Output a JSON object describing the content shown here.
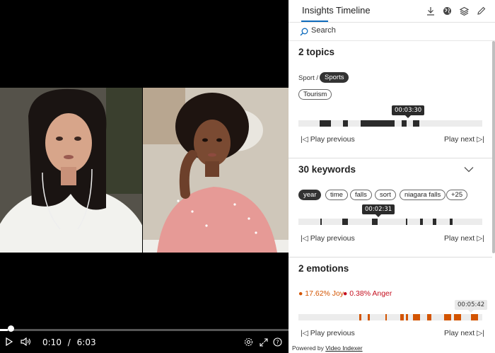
{
  "player": {
    "time_current": "0:10",
    "time_separator": "/",
    "time_total": "6:03",
    "progress": 0.028,
    "icons": {
      "play": "play-icon",
      "volume": "volume-icon",
      "settings": "settings-icon",
      "fullscreen": "fullscreen-icon",
      "help": "help-icon"
    }
  },
  "pane": {
    "tabs": [
      {
        "label": "Insights",
        "active": true
      },
      {
        "label": "Timeline",
        "active": false
      }
    ],
    "toolbar_icons": [
      "download-icon",
      "globe-icon",
      "layers-icon",
      "edit-icon"
    ],
    "search": {
      "placeholder": "Search"
    },
    "topics": {
      "title": "2 topics",
      "path_prefix": "Sport /",
      "chips": [
        {
          "label": "Sports",
          "selected": true
        },
        {
          "label": "Tourism",
          "selected": false
        }
      ],
      "tooltip": "00:03:30",
      "play_previous": "Play previous",
      "play_next": "Play next"
    },
    "keywords": {
      "title": "30 keywords",
      "chips": [
        {
          "label": "year",
          "selected": true
        },
        {
          "label": "time",
          "selected": false
        },
        {
          "label": "falls",
          "selected": false
        },
        {
          "label": "sort",
          "selected": false
        },
        {
          "label": "niagara falls",
          "selected": false
        },
        {
          "label": "+25",
          "selected": false
        }
      ],
      "tooltip": "00:02:31",
      "play_previous": "Play previous",
      "play_next": "Play next"
    },
    "emotions": {
      "title": "2 emotions",
      "items": [
        {
          "label": "17.62% Joy",
          "color": "#d35400"
        },
        {
          "label": "0.38% Anger",
          "color": "#c50f1f"
        }
      ],
      "tooltip": "00:05:42",
      "play_previous": "Play previous",
      "play_next": "Play next"
    },
    "footer": {
      "prefix": "Powered by",
      "link": "Video Indexer"
    },
    "colors": {
      "accent": "#0f6cbd",
      "joy": "#d35400",
      "anger": "#c50f1f",
      "segment": "#2b2b2b"
    }
  }
}
